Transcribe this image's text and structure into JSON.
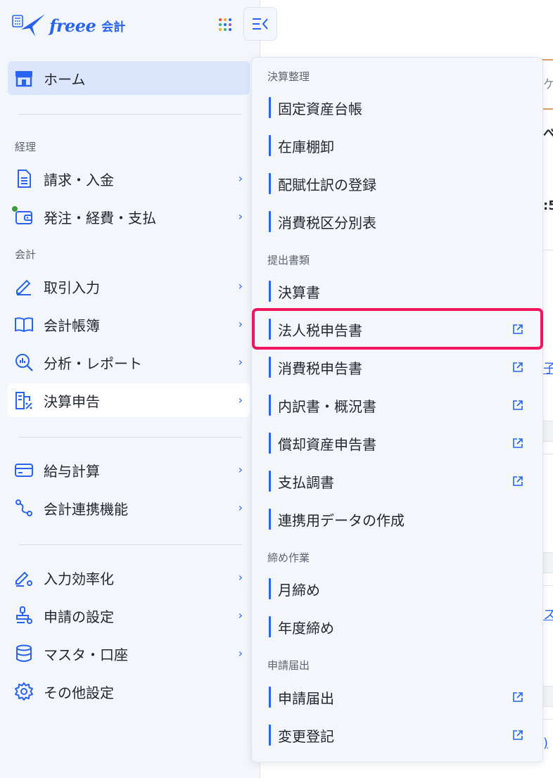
{
  "app": {
    "logo_text": "freee",
    "logo_suffix": "会計"
  },
  "sidebar": {
    "home": {
      "label": "ホーム"
    },
    "sections": [
      {
        "label": "経理"
      },
      {
        "label": "会計"
      }
    ],
    "items": [
      {
        "label": "請求・入金",
        "icon": "document-icon"
      },
      {
        "label": "発注・経費・支払",
        "icon": "wallet-icon"
      },
      {
        "label": "取引入力",
        "icon": "pen-icon"
      },
      {
        "label": "会計帳簿",
        "icon": "book-icon"
      },
      {
        "label": "分析・レポート",
        "icon": "analysis-icon"
      },
      {
        "label": "決算申告",
        "icon": "tax-return-icon"
      },
      {
        "label": "給与計算",
        "icon": "card-icon"
      },
      {
        "label": "会計連携機能",
        "icon": "link-flow-icon"
      },
      {
        "label": "入力効率化",
        "icon": "pen-gear-icon"
      },
      {
        "label": "申請の設定",
        "icon": "stamp-gear-icon"
      },
      {
        "label": "マスタ・口座",
        "icon": "database-icon"
      },
      {
        "label": "その他設定",
        "icon": "gear-icon"
      }
    ],
    "chevron": "›"
  },
  "flyout": {
    "sections": [
      {
        "label": "決算整理",
        "items": [
          {
            "label": "固定資産台帳",
            "external": false
          },
          {
            "label": "在庫棚卸",
            "external": false
          },
          {
            "label": "配賦仕訳の登録",
            "external": false
          },
          {
            "label": "消費税区分別表",
            "external": false
          }
        ]
      },
      {
        "label": "提出書類",
        "items": [
          {
            "label": "決算書",
            "external": false
          },
          {
            "label": "法人税申告書",
            "external": true,
            "highlighted": true
          },
          {
            "label": "消費税申告書",
            "external": true
          },
          {
            "label": "内訳書・概況書",
            "external": true
          },
          {
            "label": "償却資産申告書",
            "external": true
          },
          {
            "label": "支払調書",
            "external": true
          },
          {
            "label": "連携用データの作成",
            "external": false
          }
        ]
      },
      {
        "label": "締め作業",
        "items": [
          {
            "label": "月締め",
            "external": false
          },
          {
            "label": "年度締め",
            "external": false
          }
        ]
      },
      {
        "label": "申請届出",
        "items": [
          {
            "label": "申請届出",
            "external": true
          },
          {
            "label": "変更登記",
            "external": true
          }
        ]
      }
    ]
  },
  "background": {
    "fragments": [
      "ケ",
      "べ書",
      ":5",
      "子",
      "ス",
      ")"
    ]
  },
  "colors": {
    "accent": "#2864f0",
    "highlight": "#f2145e",
    "sidebar_bg": "#f3f6fb",
    "home_bg": "#dbe5fb"
  }
}
